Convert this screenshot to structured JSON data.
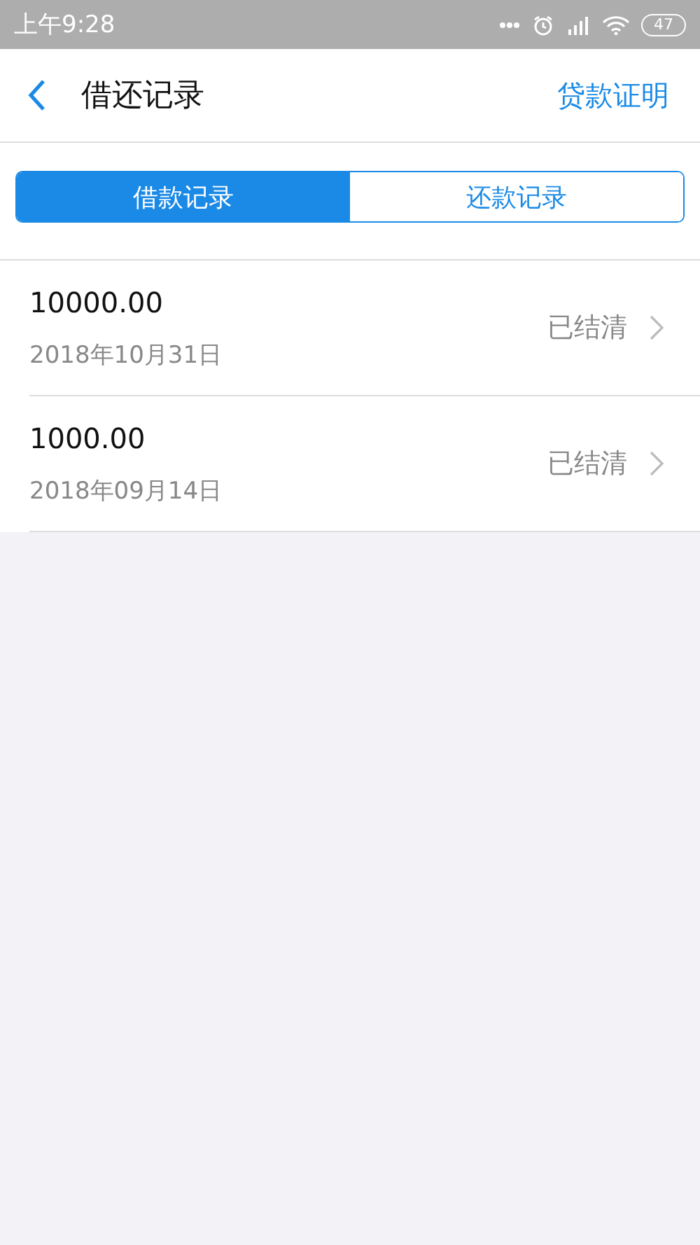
{
  "status_bar": {
    "time": "上午9:28",
    "battery": "47"
  },
  "header": {
    "title": "借还记录",
    "action": "贷款证明"
  },
  "tabs": [
    {
      "label": "借款记录",
      "selected": true
    },
    {
      "label": "还款记录",
      "selected": false
    }
  ],
  "records": [
    {
      "amount": "10000.00",
      "date": "2018年10月31日",
      "status": "已结清"
    },
    {
      "amount": "1000.00",
      "date": "2018年09月14日",
      "status": "已结清"
    }
  ]
}
